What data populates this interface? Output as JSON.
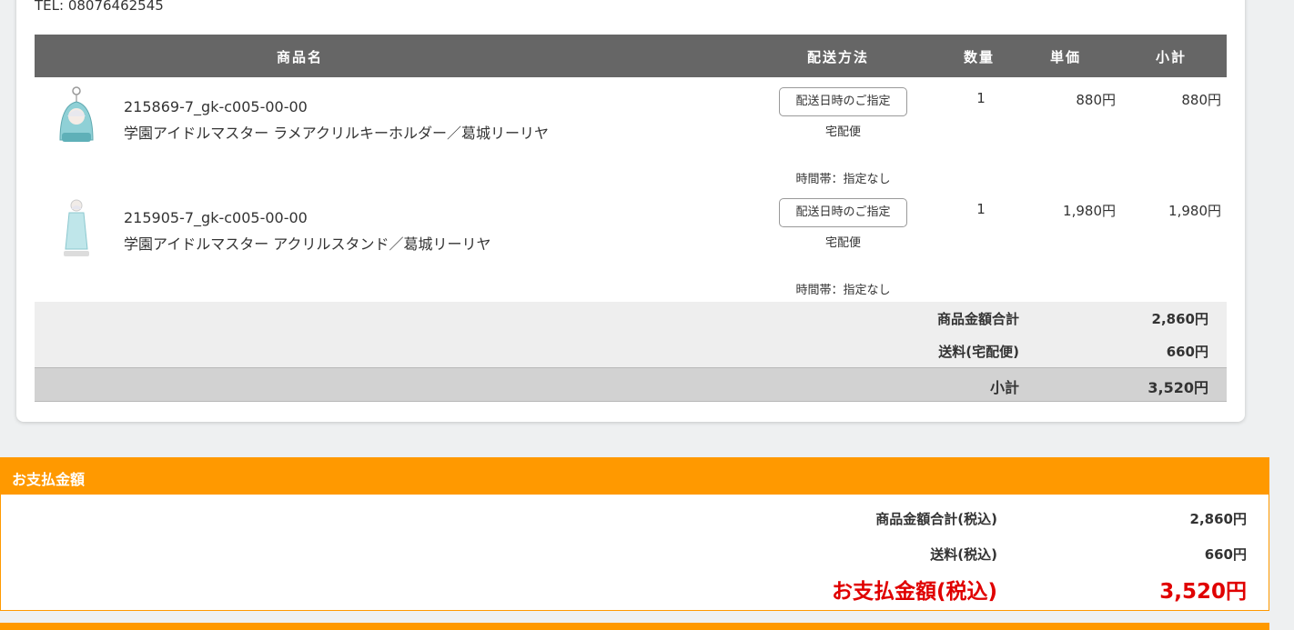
{
  "order": {
    "tel": "TEL: 08076462545",
    "columns": {
      "product": "商品名",
      "delivery": "配送方法",
      "qty": "数量",
      "unit_price": "単価",
      "subtotal": "小計"
    },
    "items": [
      {
        "code": "215869-7_gk-c005-00-00",
        "name": "学園アイドルマスター ラメアクリルキーホルダー／葛城リーリヤ",
        "delivery_button": "配送日時のご指定",
        "shipping": "宅配便",
        "time_slot": "時間帯：指定なし",
        "qty": "1",
        "unit_price": "880円",
        "subtotal": "880円"
      },
      {
        "code": "215905-7_gk-c005-00-00",
        "name": "学園アイドルマスター アクリルスタンド／葛城リーリヤ",
        "delivery_button": "配送日時のご指定",
        "shipping": "宅配便",
        "time_slot": "時間帯：指定なし",
        "qty": "1",
        "unit_price": "1,980円",
        "subtotal": "1,980円"
      }
    ],
    "summary": {
      "items_total_label": "商品金額合計",
      "items_total": "2,860円",
      "shipping_label": "送料(宅配便)",
      "shipping": "660円",
      "subtotal_label": "小計",
      "subtotal": "3,520円"
    }
  },
  "payment": {
    "title": "お支払金額",
    "items_total_label": "商品金額合計(税込)",
    "items_total": "2,860円",
    "shipping_label": "送料(税込)",
    "shipping": "660円",
    "total_label": "お支払金額(税込)",
    "total": "3,520円"
  },
  "colors": {
    "accent": "#ff9900",
    "total_red": "#e00000",
    "header_gray": "#666666"
  }
}
